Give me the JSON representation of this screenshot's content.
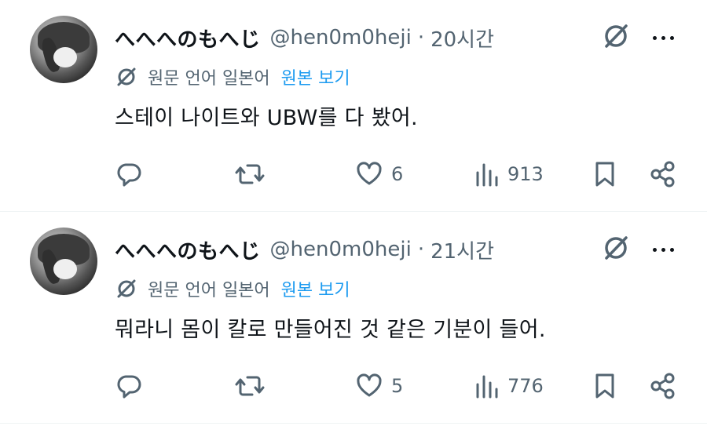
{
  "tweets": [
    {
      "name": "へへへのもへじ",
      "handle": "@hen0m0heji",
      "separator": "·",
      "time": "20시간",
      "translate_label": "원문 언어 일본어",
      "translate_link": "원본 보기",
      "text": "스테이 나이트와 UBW를 다 봤어.",
      "likes": "6",
      "views": "913"
    },
    {
      "name": "へへへのもへじ",
      "handle": "@hen0m0heji",
      "separator": "·",
      "time": "21시간",
      "translate_label": "원문 언어 일본어",
      "translate_link": "원본 보기",
      "text": "뭐라니 몸이 칼로 만들어진 것 같은 기분이 들어.",
      "likes": "5",
      "views": "776"
    }
  ],
  "colors": {
    "text": "#0f1419",
    "secondary": "#536471",
    "link": "#1d9bf0",
    "divider": "#eff3f4"
  },
  "icons": {
    "grok": "grok-icon",
    "more": "more-icon",
    "translate": "translate-icon",
    "reply": "reply-icon",
    "retweet": "retweet-icon",
    "like": "heart-icon",
    "views": "views-icon",
    "bookmark": "bookmark-icon",
    "share": "share-icon"
  }
}
